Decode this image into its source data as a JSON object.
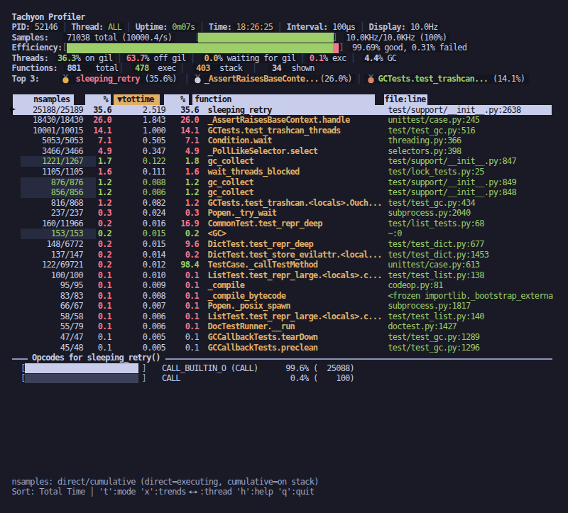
{
  "colors": {
    "bg": "#191a25",
    "fg": "#c6cde8",
    "dim": "#9aa3c7",
    "label": "#b6bdd8",
    "green": "#9ece6a",
    "amber": "#e0af68",
    "red": "#f7768e",
    "sep": "#3b4261",
    "bracket": "#6e7763",
    "sel_bg": "#c9cdec",
    "sel_fg": "#15161e",
    "head_bg": "#c9cdec",
    "head_fg": "#15161e",
    "sort_col_bg": "#e0af68",
    "bar_green": "#9ece6a",
    "bar_pink": "#f7768e",
    "bar_filled": "#c9cdec",
    "bar_empty": "#3d4059",
    "flash_bg": "#272b40",
    "pill_bg": "#14151e",
    "rule": "#8a93bb",
    "marker": "#0b0b10"
  },
  "title": "Tachyon Profiler",
  "status": {
    "separator": "│",
    "pid_label": "PID:",
    "pid_value": "52146",
    "thread_label": "Thread:",
    "thread_value": "ALL",
    "uptime_label": "Uptime:",
    "uptime_value": "0m07s",
    "time_label": "Time:",
    "time_value": "18:26:25",
    "interval_label": "Interval:",
    "interval_value": "100µs",
    "display_label": "Display:",
    "display_value": "10.0Hz"
  },
  "samples": {
    "label": "Samples:",
    "value_text": "71038 total (10000.4/s)",
    "bar_open": "[",
    "bar_close": "]",
    "bar_pct": 100,
    "rate_text": "10.0KHz/10.0KHz (100%)"
  },
  "efficiency": {
    "label": "Efficiency:",
    "bar_open": "[",
    "bar_close": "]",
    "good_pct": 99.69,
    "failed_pct": 0.31,
    "summary_text": "99.69% good, 0.31% failed"
  },
  "threads": {
    "label": "Threads:",
    "segments": [
      {
        "value": "36.3",
        "unit": "% on gil",
        "color": "green"
      },
      {
        "value": "63.7",
        "unit": "% off gil",
        "color": "red"
      },
      {
        "value": "0.0",
        "unit": "% waiting for gil",
        "color": "amber"
      },
      {
        "value": "0.1",
        "unit": "% exc",
        "color": "red"
      },
      {
        "value": "4.4",
        "unit": "% GC",
        "color": "fg"
      }
    ]
  },
  "functions": {
    "label": "Functions:",
    "segments": [
      {
        "value": "881",
        "unit": "total",
        "color": "fg"
      },
      {
        "value": "478",
        "unit": "exec",
        "color": "green"
      },
      {
        "value": "403",
        "unit": "stack",
        "color": "amber"
      },
      {
        "value": "34",
        "unit": "shown",
        "color": "fg"
      }
    ]
  },
  "top3": {
    "label": "Top 3:",
    "entries": [
      {
        "rank": 1,
        "medal": "gold",
        "name": "sleeping_retry",
        "pct": "(35.6%)",
        "color": "red"
      },
      {
        "rank": 2,
        "medal": "silver",
        "name": "_AssertRaisesBaseConte...",
        "pct": "(26.0%)",
        "color": "amber"
      },
      {
        "rank": 3,
        "medal": "bronze",
        "name": "GCTests.test_trashcan...",
        "pct": "(14.1%)",
        "color": "green"
      }
    ]
  },
  "table": {
    "columns": [
      {
        "label": "nsamples"
      },
      {
        "label": "%"
      },
      {
        "label": "▼tottime",
        "sorted": true
      },
      {
        "label": "%"
      },
      {
        "label": "function"
      },
      {
        "label": "file:line"
      }
    ],
    "rows": [
      {
        "selected": true,
        "flash": false,
        "nsamples": "25188/25189",
        "ns_c": "fg",
        "pct": "35.6",
        "pct_c": "fg",
        "tottime": "2.519",
        "tt_c": "fg",
        "cum": "35.6",
        "cum_c": "fg",
        "function": "sleeping_retry",
        "file": "test/support/__init__.py:2638"
      },
      {
        "selected": false,
        "flash": false,
        "nsamples": "18430/18430",
        "ns_c": "fg",
        "pct": "26.0",
        "pct_c": "red",
        "tottime": "1.843",
        "tt_c": "fg",
        "cum": "26.0",
        "cum_c": "red",
        "function": "_AssertRaisesBaseContext.handle",
        "file": "unittest/case.py:245"
      },
      {
        "selected": false,
        "flash": false,
        "nsamples": "10001/10015",
        "ns_c": "fg",
        "pct": "14.1",
        "pct_c": "red",
        "tottime": "1.000",
        "tt_c": "fg",
        "cum": "14.1",
        "cum_c": "red",
        "function": "GCTests.test_trashcan_threads",
        "file": "test/test_gc.py:516"
      },
      {
        "selected": false,
        "flash": false,
        "nsamples": "5053/5053",
        "ns_c": "fg",
        "pct": "7.1",
        "pct_c": "red",
        "tottime": "0.505",
        "tt_c": "fg",
        "cum": "7.1",
        "cum_c": "red",
        "function": "Condition.wait",
        "file": "threading.py:366"
      },
      {
        "selected": false,
        "flash": false,
        "nsamples": "3466/3466",
        "ns_c": "fg",
        "pct": "4.9",
        "pct_c": "red",
        "tottime": "0.347",
        "tt_c": "fg",
        "cum": "4.9",
        "cum_c": "red",
        "function": "_PollLikeSelector.select",
        "file": "selectors.py:398"
      },
      {
        "selected": false,
        "flash": true,
        "nsamples": "1221/1267",
        "ns_c": "green",
        "pct": "1.7",
        "pct_c": "green",
        "tottime": "0.122",
        "tt_c": "green",
        "cum": "1.8",
        "cum_c": "green",
        "function": "gc_collect",
        "file": "test/support/__init__.py:847"
      },
      {
        "selected": false,
        "flash": false,
        "nsamples": "1105/1105",
        "ns_c": "fg",
        "pct": "1.6",
        "pct_c": "red",
        "tottime": "0.111",
        "tt_c": "fg",
        "cum": "1.6",
        "cum_c": "red",
        "function": "wait_threads_blocked",
        "file": "test/lock_tests.py:25"
      },
      {
        "selected": false,
        "flash": true,
        "nsamples": "876/876",
        "ns_c": "green",
        "pct": "1.2",
        "pct_c": "green",
        "tottime": "0.088",
        "tt_c": "green",
        "cum": "1.2",
        "cum_c": "green",
        "function": "gc_collect",
        "file": "test/support/__init__.py:849"
      },
      {
        "selected": false,
        "flash": true,
        "nsamples": "856/856",
        "ns_c": "green",
        "pct": "1.2",
        "pct_c": "green",
        "tottime": "0.086",
        "tt_c": "green",
        "cum": "1.2",
        "cum_c": "green",
        "function": "gc_collect",
        "file": "test/support/__init__.py:848"
      },
      {
        "selected": false,
        "flash": false,
        "nsamples": "816/868",
        "ns_c": "fg",
        "pct": "1.2",
        "pct_c": "red",
        "tottime": "0.082",
        "tt_c": "fg",
        "cum": "1.2",
        "cum_c": "red",
        "function": "GCTests.test_trashcan.<locals>.Ouch...",
        "file": "test/test_gc.py:434"
      },
      {
        "selected": false,
        "flash": false,
        "nsamples": "237/237",
        "ns_c": "fg",
        "pct": "0.3",
        "pct_c": "red",
        "tottime": "0.024",
        "tt_c": "fg",
        "cum": "0.3",
        "cum_c": "red",
        "function": "Popen._try_wait",
        "file": "subprocess.py:2040"
      },
      {
        "selected": false,
        "flash": false,
        "nsamples": "160/11966",
        "ns_c": "fg",
        "pct": "0.2",
        "pct_c": "red",
        "tottime": "0.016",
        "tt_c": "fg",
        "cum": "16.9",
        "cum_c": "red",
        "function": "CommonTest.test_repr_deep",
        "file": "test/list_tests.py:68"
      },
      {
        "selected": false,
        "flash": true,
        "nsamples": "153/153",
        "ns_c": "green",
        "pct": "0.2",
        "pct_c": "green",
        "tottime": "0.015",
        "tt_c": "green",
        "cum": "0.2",
        "cum_c": "green",
        "function": "<GC>",
        "file": "~:0"
      },
      {
        "selected": false,
        "flash": false,
        "nsamples": "148/6772",
        "ns_c": "fg",
        "pct": "0.2",
        "pct_c": "red",
        "tottime": "0.015",
        "tt_c": "fg",
        "cum": "9.6",
        "cum_c": "red",
        "function": "DictTest.test_repr_deep",
        "file": "test/test_dict.py:677"
      },
      {
        "selected": false,
        "flash": false,
        "nsamples": "137/147",
        "ns_c": "fg",
        "pct": "0.2",
        "pct_c": "red",
        "tottime": "0.014",
        "tt_c": "fg",
        "cum": "0.2",
        "cum_c": "red",
        "function": "DictTest.test_store_evilattr.<local...",
        "file": "test/test_dict.py:1453"
      },
      {
        "selected": false,
        "flash": false,
        "nsamples": "122/69721",
        "ns_c": "fg",
        "pct": "0.2",
        "pct_c": "red",
        "tottime": "0.012",
        "tt_c": "fg",
        "cum": "98.4",
        "cum_c": "green",
        "function": "TestCase._callTestMethod",
        "file": "unittest/case.py:613"
      },
      {
        "selected": false,
        "flash": false,
        "nsamples": "100/100",
        "ns_c": "fg",
        "pct": "0.1",
        "pct_c": "red",
        "tottime": "0.010",
        "tt_c": "fg",
        "cum": "0.1",
        "cum_c": "red",
        "function": "ListTest.test_repr_large.<locals>.c...",
        "file": "test/test_list.py:138"
      },
      {
        "selected": false,
        "flash": false,
        "nsamples": "95/95",
        "ns_c": "fg",
        "pct": "0.1",
        "pct_c": "red",
        "tottime": "0.009",
        "tt_c": "fg",
        "cum": "0.1",
        "cum_c": "red",
        "function": "_compile",
        "file": "codeop.py:81"
      },
      {
        "selected": false,
        "flash": false,
        "nsamples": "83/83",
        "ns_c": "fg",
        "pct": "0.1",
        "pct_c": "red",
        "tottime": "0.008",
        "tt_c": "fg",
        "cum": "0.1",
        "cum_c": "red",
        "function": "_compile_bytecode",
        "file": "<frozen importlib._bootstrap_externa"
      },
      {
        "selected": false,
        "flash": false,
        "nsamples": "66/67",
        "ns_c": "fg",
        "pct": "0.1",
        "pct_c": "red",
        "tottime": "0.007",
        "tt_c": "fg",
        "cum": "0.1",
        "cum_c": "red",
        "function": "Popen._posix_spawn",
        "file": "subprocess.py:1817"
      },
      {
        "selected": false,
        "flash": false,
        "nsamples": "58/58",
        "ns_c": "fg",
        "pct": "0.1",
        "pct_c": "red",
        "tottime": "0.006",
        "tt_c": "fg",
        "cum": "0.1",
        "cum_c": "red",
        "function": "ListTest.test_repr_large.<locals>.c...",
        "file": "test/test_list.py:140"
      },
      {
        "selected": false,
        "flash": false,
        "nsamples": "55/79",
        "ns_c": "fg",
        "pct": "0.1",
        "pct_c": "red",
        "tottime": "0.006",
        "tt_c": "fg",
        "cum": "0.1",
        "cum_c": "red",
        "function": "DocTestRunner.__run",
        "file": "doctest.py:1427"
      },
      {
        "selected": false,
        "flash": false,
        "nsamples": "47/47",
        "ns_c": "fg",
        "pct": "0.1",
        "pct_c": "fg",
        "tottime": "0.005",
        "tt_c": "fg",
        "cum": "0.1",
        "cum_c": "fg",
        "function": "GCCallbackTests.tearDown",
        "file": "test/test_gc.py:1289"
      },
      {
        "selected": false,
        "flash": false,
        "nsamples": "45/48",
        "ns_c": "fg",
        "pct": "0.1",
        "pct_c": "fg",
        "tottime": "0.005",
        "tt_c": "fg",
        "cum": "0.1",
        "cum_c": "fg",
        "function": "GCCallbackTests.preclean",
        "file": "test/test_gc.py:1296"
      }
    ]
  },
  "opcodes": {
    "heading": "Opcodes for sleeping_retry()",
    "rows": [
      {
        "bar_open": "[",
        "bar_close": "]",
        "bar_pct": 99.6,
        "name": "CALL_BUILTIN_O (CALL)",
        "stat": "99.6% (  25088)"
      },
      {
        "bar_open": "[",
        "bar_close": "]",
        "bar_pct": 0.4,
        "name": "CALL",
        "stat": " 0.4% (    100)"
      }
    ]
  },
  "footer": {
    "line1": "nsamples: direct/cumulative (direct=executing, cumulative=on stack)",
    "line2_label": "Sort: Total Time",
    "line2_mid": "│ 't':mode 'x':trends",
    "line2_arrow": "↔",
    "line2_end": ":thread 'h':help 'q':quit"
  }
}
